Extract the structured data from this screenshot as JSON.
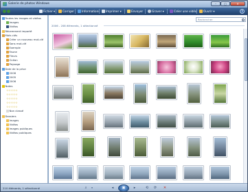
{
  "window": {
    "title": "Galerie de photos Windows"
  },
  "toolbar": {
    "items": [
      "Fichier",
      "Corriger",
      "Informations",
      "Imprimer",
      "Envoyer",
      "Graver",
      "Créer une vidéo",
      "Ouvrir"
    ],
    "help": "?"
  },
  "sidebar": {
    "items": [
      "Toutes les images et vidéos",
      "Images",
      "Vidéos",
      "Récemment importé",
      "Mots clés",
      "Créer un nouveau mot-clé",
      "Sans mot-clé",
      "Exemple",
      "Faune",
      "Fleurs",
      "Océan",
      "Paysage",
      "Date de la prise",
      "2006",
      "2005",
      "2006",
      "Notes",
      "Non classé",
      "Dossiers",
      "Images",
      "Vidéos",
      "Images publiques",
      "Vidéos publiques"
    ]
  },
  "content": {
    "search_placeholder": "Rechercher",
    "group_header": "2006 - 208 éléments, 1 sélectionné"
  },
  "statusbar": {
    "text": "210 éléments, 1 sélectionné",
    "controls": [
      "⌕",
      "▾",
      "◂",
      "▣",
      "▸",
      "⟲",
      "⟳",
      "✕"
    ]
  },
  "colors": {
    "toolbar_bg": "#1f3f6b",
    "window_chrome": "#a9c2de",
    "close_button": "#c4412a"
  }
}
